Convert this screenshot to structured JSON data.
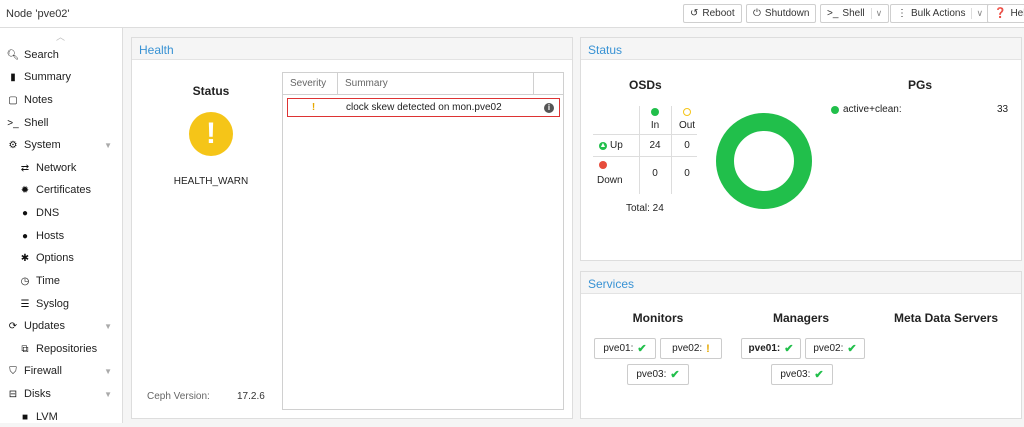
{
  "node_title": "Node 'pve02'",
  "toolbar": {
    "reboot": "Reboot",
    "shutdown": "Shutdown",
    "shell": "Shell",
    "bulk_actions": "Bulk Actions",
    "help": "Help"
  },
  "sidebar": {
    "items": [
      {
        "label": "Search",
        "icon": "search-icon"
      },
      {
        "label": "Summary",
        "icon": "book-icon"
      },
      {
        "label": "Notes",
        "icon": "note-icon"
      },
      {
        "label": "Shell",
        "icon": "terminal-icon"
      },
      {
        "label": "System",
        "icon": "cogs-icon"
      },
      {
        "label": "Network",
        "icon": "exchange-icon"
      },
      {
        "label": "Certificates",
        "icon": "certificate-icon"
      },
      {
        "label": "DNS",
        "icon": "globe-icon"
      },
      {
        "label": "Hosts",
        "icon": "globe-icon"
      },
      {
        "label": "Options",
        "icon": "gear-icon"
      },
      {
        "label": "Time",
        "icon": "clock-icon"
      },
      {
        "label": "Syslog",
        "icon": "list-icon"
      },
      {
        "label": "Updates",
        "icon": "refresh-icon"
      },
      {
        "label": "Repositories",
        "icon": "files-icon"
      },
      {
        "label": "Firewall",
        "icon": "shield-icon"
      },
      {
        "label": "Disks",
        "icon": "hdd-icon"
      },
      {
        "label": "LVM",
        "icon": "square-icon"
      }
    ]
  },
  "health": {
    "panel_title": "Health",
    "status_title": "Status",
    "status_value": "HEALTH_WARN",
    "ceph_version_label": "Ceph Version:",
    "ceph_version_value": "17.2.6",
    "grid_headers": {
      "severity": "Severity",
      "summary": "Summary"
    },
    "rows": [
      {
        "severity": "!",
        "summary": "clock skew detected on mon.pve02"
      }
    ]
  },
  "status": {
    "panel_title": "Status",
    "osds": {
      "title": "OSDs",
      "col_in": "In",
      "col_out": "Out",
      "row_up": "Up",
      "row_down": "Down",
      "up_in": "24",
      "up_out": "0",
      "down_in": "0",
      "down_out": "0",
      "total": "Total: 24"
    },
    "pgs": {
      "title": "PGs",
      "state": "active+clean:",
      "count": "33",
      "fill_fraction": 1.0
    },
    "colors": {
      "ok": "#21bf4b",
      "warn": "#f5c518",
      "error": "#e74c3c"
    }
  },
  "services": {
    "panel_title": "Services",
    "monitors_title": "Monitors",
    "managers_title": "Managers",
    "mds_title": "Meta Data Servers",
    "monitors": [
      {
        "label": "pve01:",
        "state": "ok"
      },
      {
        "label": "pve02:",
        "state": "warn"
      },
      {
        "label": "pve03:",
        "state": "ok"
      }
    ],
    "managers": [
      {
        "label": "pve01:",
        "state": "ok",
        "active": true
      },
      {
        "label": "pve02:",
        "state": "ok"
      },
      {
        "label": "pve03:",
        "state": "ok"
      }
    ]
  }
}
